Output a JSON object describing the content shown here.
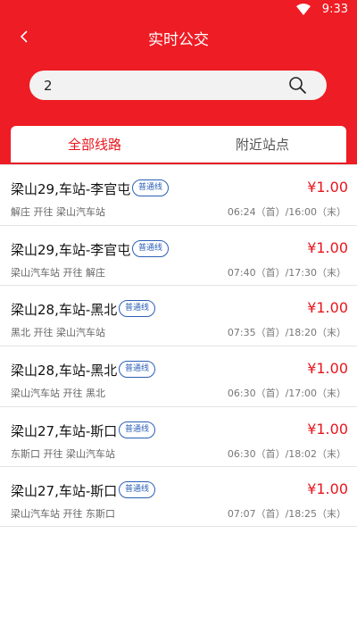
{
  "status": {
    "time": "9:33"
  },
  "header": {
    "title": "实时公交"
  },
  "search": {
    "value": "2"
  },
  "tabs": [
    {
      "label": "全部线路",
      "active": true
    },
    {
      "label": "附近站点",
      "active": false
    }
  ],
  "routes": [
    {
      "name": "梁山29,车站-李官屯",
      "badge": "普通线",
      "price": "¥1.00",
      "direction": "解庄 开往 梁山汽车站",
      "schedule": "06:24（首）/16:00（末）"
    },
    {
      "name": "梁山29,车站-李官屯",
      "badge": "普通线",
      "price": "¥1.00",
      "direction": "梁山汽车站 开往 解庄",
      "schedule": "07:40（首）/17:30（末）"
    },
    {
      "name": "梁山28,车站-黑北",
      "badge": "普通线",
      "price": "¥1.00",
      "direction": "黑北 开往 梁山汽车站",
      "schedule": "07:35（首）/18:20（末）"
    },
    {
      "name": "梁山28,车站-黑北",
      "badge": "普通线",
      "price": "¥1.00",
      "direction": "梁山汽车站 开往 黑北",
      "schedule": "06:30（首）/17:00（末）"
    },
    {
      "name": "梁山27,车站-斯口",
      "badge": "普通线",
      "price": "¥1.00",
      "direction": "东斯口 开往 梁山汽车站",
      "schedule": "06:30（首）/18:02（末）"
    },
    {
      "name": "梁山27,车站-斯口",
      "badge": "普通线",
      "price": "¥1.00",
      "direction": "梁山汽车站 开往 东斯口",
      "schedule": "07:07（首）/18:25（末）"
    }
  ],
  "colors": {
    "header": "#ee1c24",
    "accent": "#e8161e",
    "badge": "#2b5fb6"
  },
  "icons": {
    "back": "chevron-left-icon",
    "search": "search-icon",
    "wifi": "wifi-icon"
  }
}
